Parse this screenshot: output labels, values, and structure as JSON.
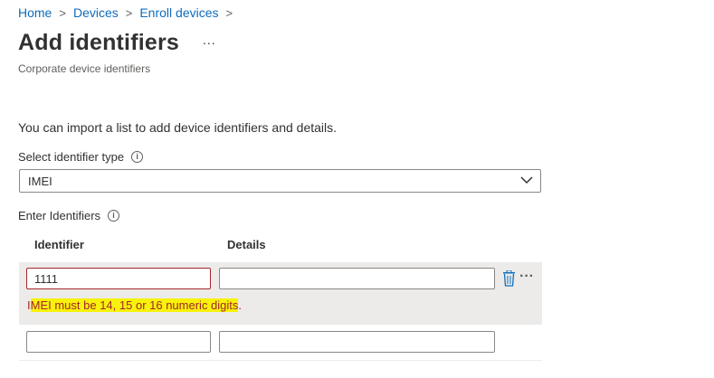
{
  "breadcrumb": [
    {
      "label": "Home"
    },
    {
      "label": "Devices"
    },
    {
      "label": "Enroll devices"
    }
  ],
  "breadcrumb_separator": ">",
  "page": {
    "title": "Add identifiers",
    "more": "...",
    "subtitle": "Corporate device identifiers"
  },
  "form": {
    "intro": "You can import a list to add device identifiers and details.",
    "type_label": "Select identifier type",
    "type_value": "IMEI",
    "identifiers_label": "Enter Identifiers",
    "info_glyph": "i",
    "columns": {
      "identifier": "Identifier",
      "details": "Details"
    },
    "rows": [
      {
        "identifier": "1111",
        "details": "",
        "error": "IMEI must be 14, 15 or 16 numeric digits."
      },
      {
        "identifier": "",
        "details": ""
      }
    ],
    "error_first_char": "I",
    "error_highlighted": "MEI must be 14, 15 or 16 numeric digits",
    "error_tail": ".",
    "row_more": "···"
  },
  "colors": {
    "link": "#0f6cbd",
    "error": "#a4262c",
    "highlight": "#f7f20a",
    "row_background": "#edebe9"
  },
  "icons": [
    "chevron-right-icon",
    "info-icon",
    "chevron-down-icon",
    "trash-icon",
    "more-icon"
  ]
}
